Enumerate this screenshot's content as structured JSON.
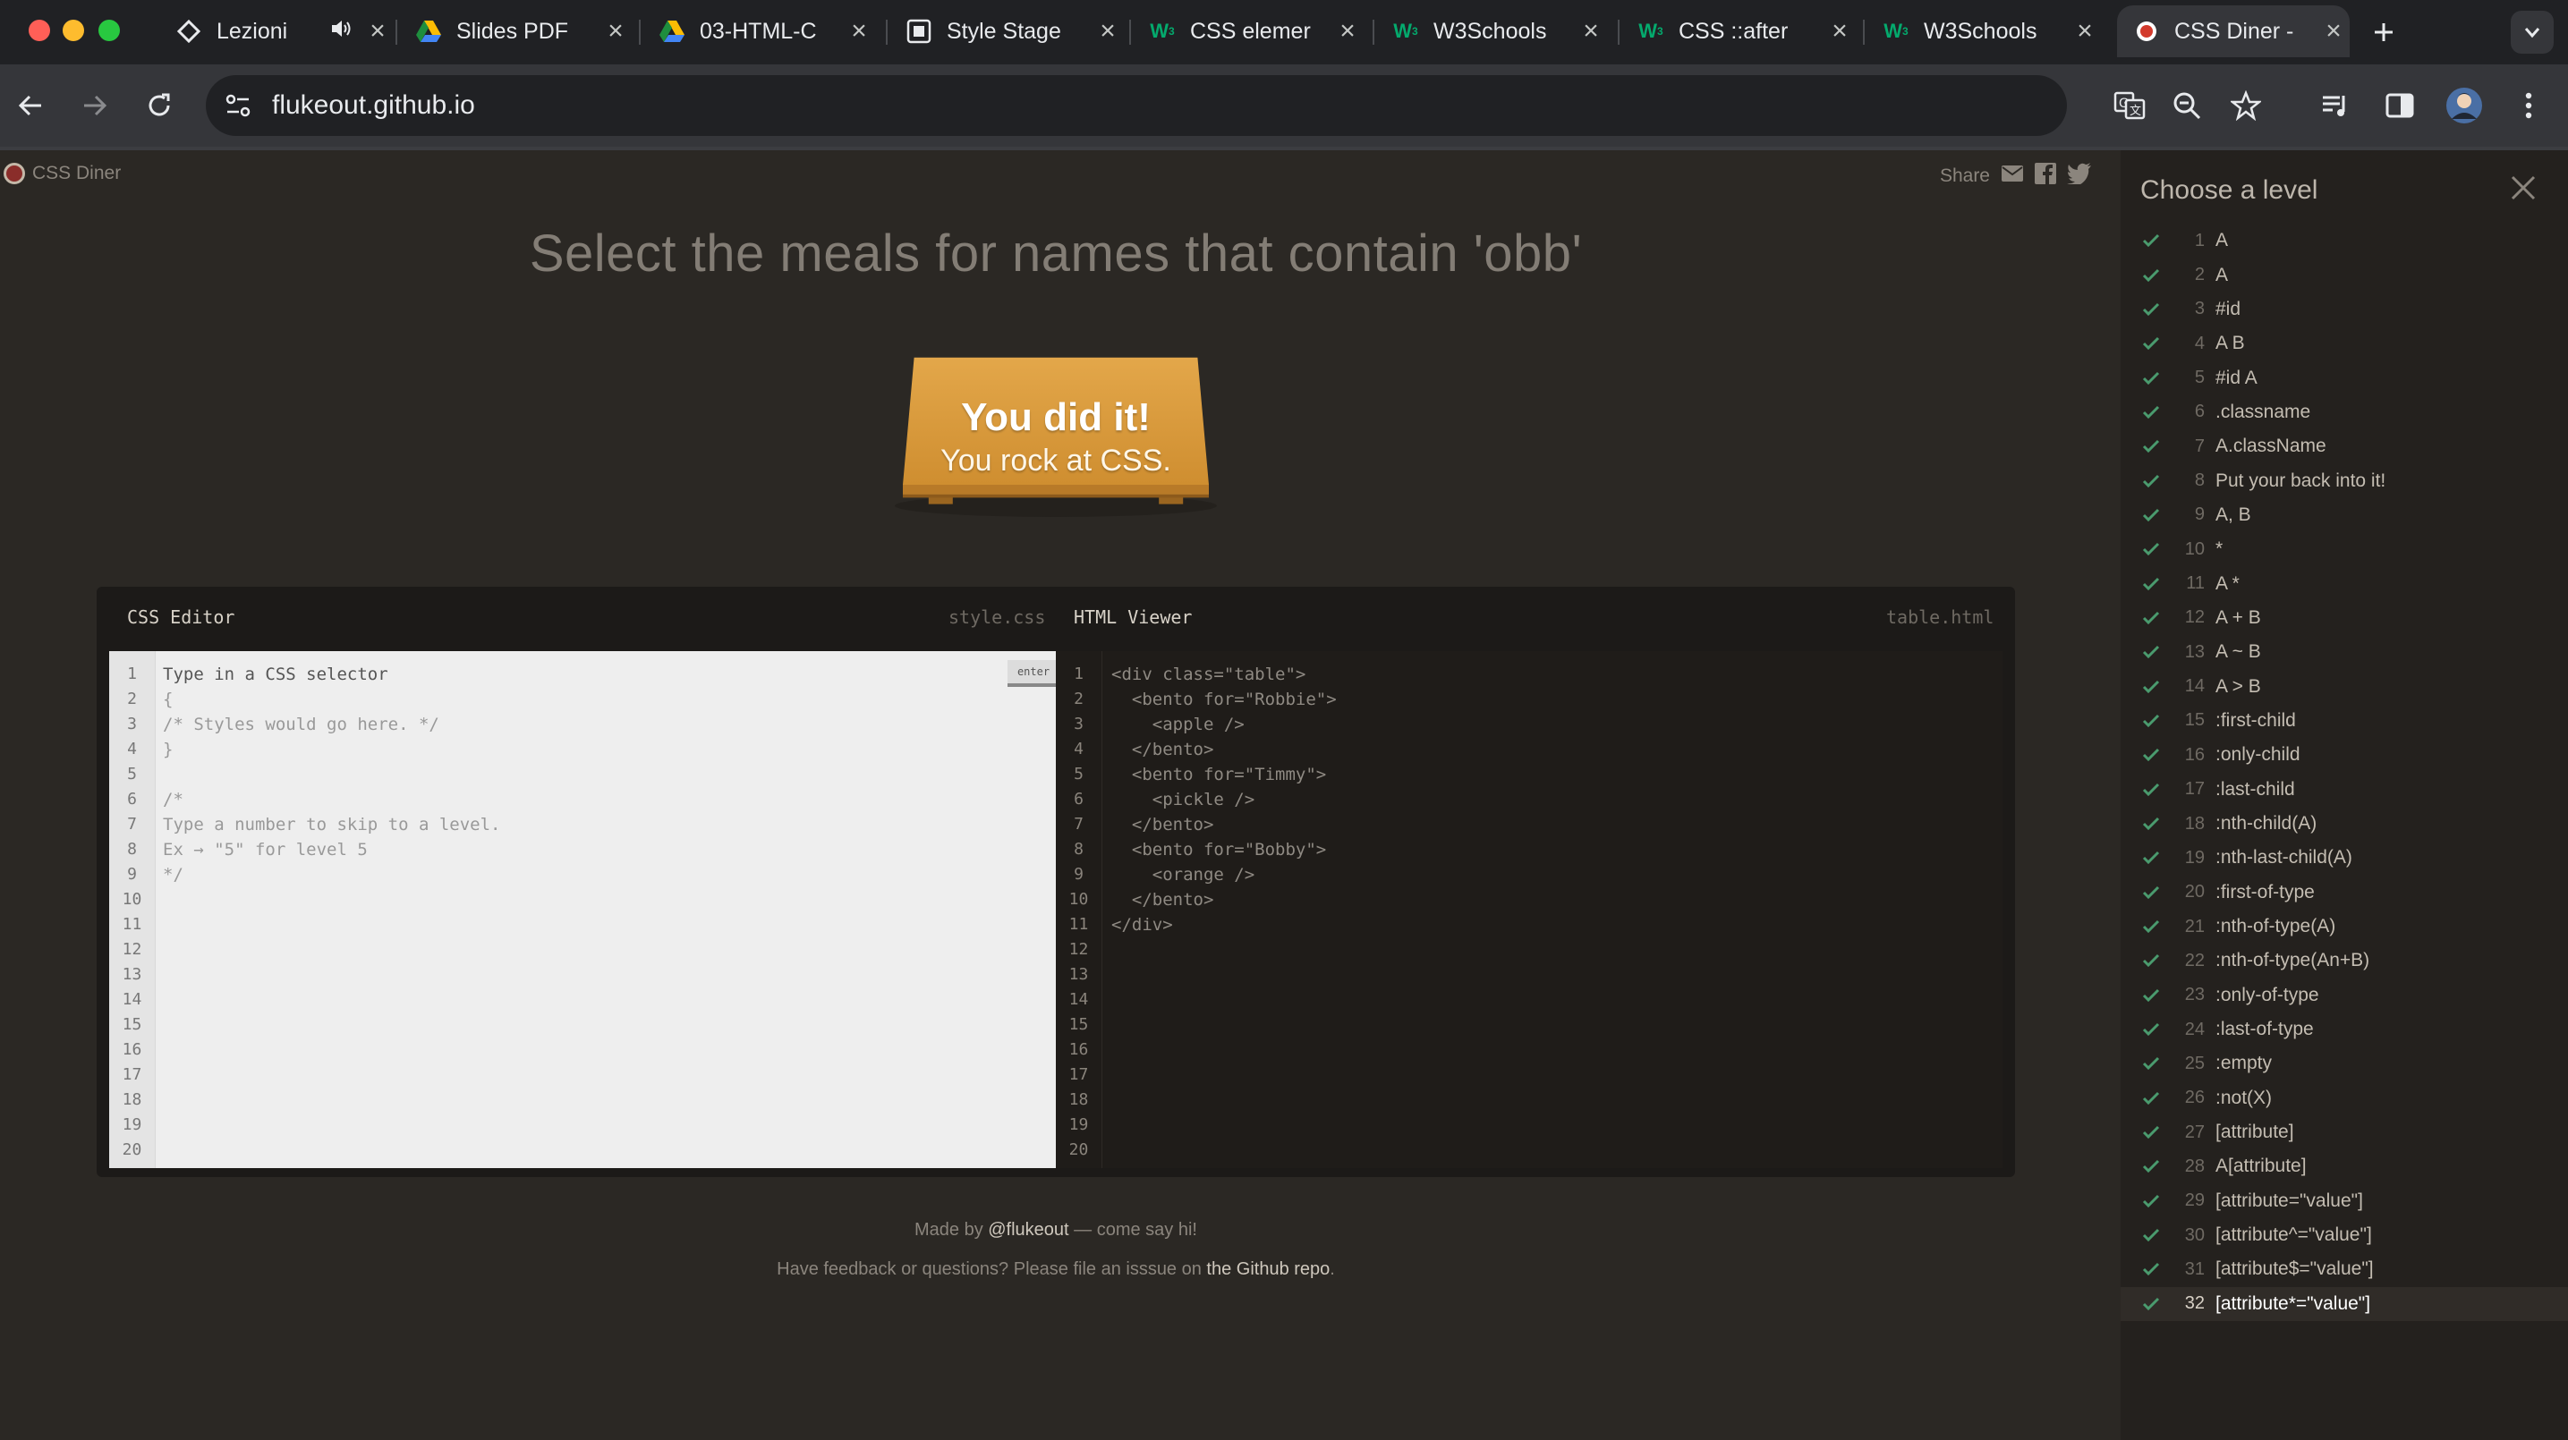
{
  "browser": {
    "tabs": [
      {
        "title": "Lezioni",
        "icon": "codepen-icon"
      },
      {
        "title": "Slides PDF",
        "icon": "google-drive-icon"
      },
      {
        "title": "03-HTML-C",
        "icon": "google-drive-icon"
      },
      {
        "title": "Style Stage",
        "icon": "style-stage-icon"
      },
      {
        "title": "CSS elemer",
        "icon": "w3schools-icon"
      },
      {
        "title": "W3Schools",
        "icon": "w3schools-icon"
      },
      {
        "title": "CSS ::after",
        "icon": "w3schools-icon"
      },
      {
        "title": "W3Schools",
        "icon": "w3schools-icon"
      },
      {
        "title": "CSS Diner -",
        "icon": "css-diner-icon",
        "active": true
      }
    ],
    "url": "flukeout.github.io"
  },
  "page": {
    "logo_text": "CSS Diner",
    "share_label": "Share",
    "instruction": "Select the meals for names that contain 'obb'",
    "win_title": "You did it!",
    "win_subtitle": "You rock at CSS.",
    "css_editor": {
      "label": "CSS Editor",
      "filename": "style.css",
      "enter_label": "enter",
      "lines": [
        "Type in a CSS selector",
        "{",
        "/* Styles would go here. */",
        "}",
        "",
        "/*",
        "Type a number to skip to a level.",
        "Ex → \"5\" for level 5",
        "*/"
      ]
    },
    "html_viewer": {
      "label": "HTML Viewer",
      "filename": "table.html",
      "lines": [
        "<div class=\"table\">",
        "  <bento for=\"Robbie\">",
        "    <apple />",
        "  </bento>",
        "  <bento for=\"Timmy\">",
        "    <pickle />",
        "  </bento>",
        "  <bento for=\"Bobby\">",
        "    <orange />",
        "  </bento>",
        "</div>"
      ]
    },
    "line_numbers": [
      "1",
      "2",
      "3",
      "4",
      "5",
      "6",
      "7",
      "8",
      "9",
      "10",
      "11",
      "12",
      "13",
      "14",
      "15",
      "16",
      "17",
      "18",
      "19",
      "20"
    ],
    "footer": {
      "made_by": "Made by ",
      "author": "@flukeout",
      "made_by_suffix": " — come say hi!",
      "feedback": "Have feedback or questions? Please file an isssue on ",
      "repo_link": "the Github repo",
      "feedback_suffix": "."
    }
  },
  "sidebar": {
    "title": "Choose a level",
    "current_level": "32",
    "levels": [
      {
        "num": "1",
        "selector": "A"
      },
      {
        "num": "2",
        "selector": "A"
      },
      {
        "num": "3",
        "selector": "#id"
      },
      {
        "num": "4",
        "selector": "A B"
      },
      {
        "num": "5",
        "selector": "#id A"
      },
      {
        "num": "6",
        "selector": ".classname"
      },
      {
        "num": "7",
        "selector": "A.className"
      },
      {
        "num": "8",
        "selector": "Put your back into it!"
      },
      {
        "num": "9",
        "selector": "A, B"
      },
      {
        "num": "10",
        "selector": "*"
      },
      {
        "num": "11",
        "selector": "A *"
      },
      {
        "num": "12",
        "selector": "A + B"
      },
      {
        "num": "13",
        "selector": "A ~ B"
      },
      {
        "num": "14",
        "selector": "A > B"
      },
      {
        "num": "15",
        "selector": ":first-child"
      },
      {
        "num": "16",
        "selector": ":only-child"
      },
      {
        "num": "17",
        "selector": ":last-child"
      },
      {
        "num": "18",
        "selector": ":nth-child(A)"
      },
      {
        "num": "19",
        "selector": ":nth-last-child(A)"
      },
      {
        "num": "20",
        "selector": ":first-of-type"
      },
      {
        "num": "21",
        "selector": ":nth-of-type(A)"
      },
      {
        "num": "22",
        "selector": ":nth-of-type(An+B)"
      },
      {
        "num": "23",
        "selector": ":only-of-type"
      },
      {
        "num": "24",
        "selector": ":last-of-type"
      },
      {
        "num": "25",
        "selector": ":empty"
      },
      {
        "num": "26",
        "selector": ":not(X)"
      },
      {
        "num": "27",
        "selector": "[attribute]"
      },
      {
        "num": "28",
        "selector": "A[attribute]"
      },
      {
        "num": "29",
        "selector": "[attribute=\"value\"]"
      },
      {
        "num": "30",
        "selector": "[attribute^=\"value\"]"
      },
      {
        "num": "31",
        "selector": "[attribute$=\"value\"]"
      },
      {
        "num": "32",
        "selector": "[attribute*=\"value\"]"
      }
    ]
  },
  "colors": {
    "page_bg": "#2b2824",
    "table_wood": "#d9993a",
    "check_green": "#4a9b6e",
    "css_editor_bg": "#eeeeee"
  }
}
